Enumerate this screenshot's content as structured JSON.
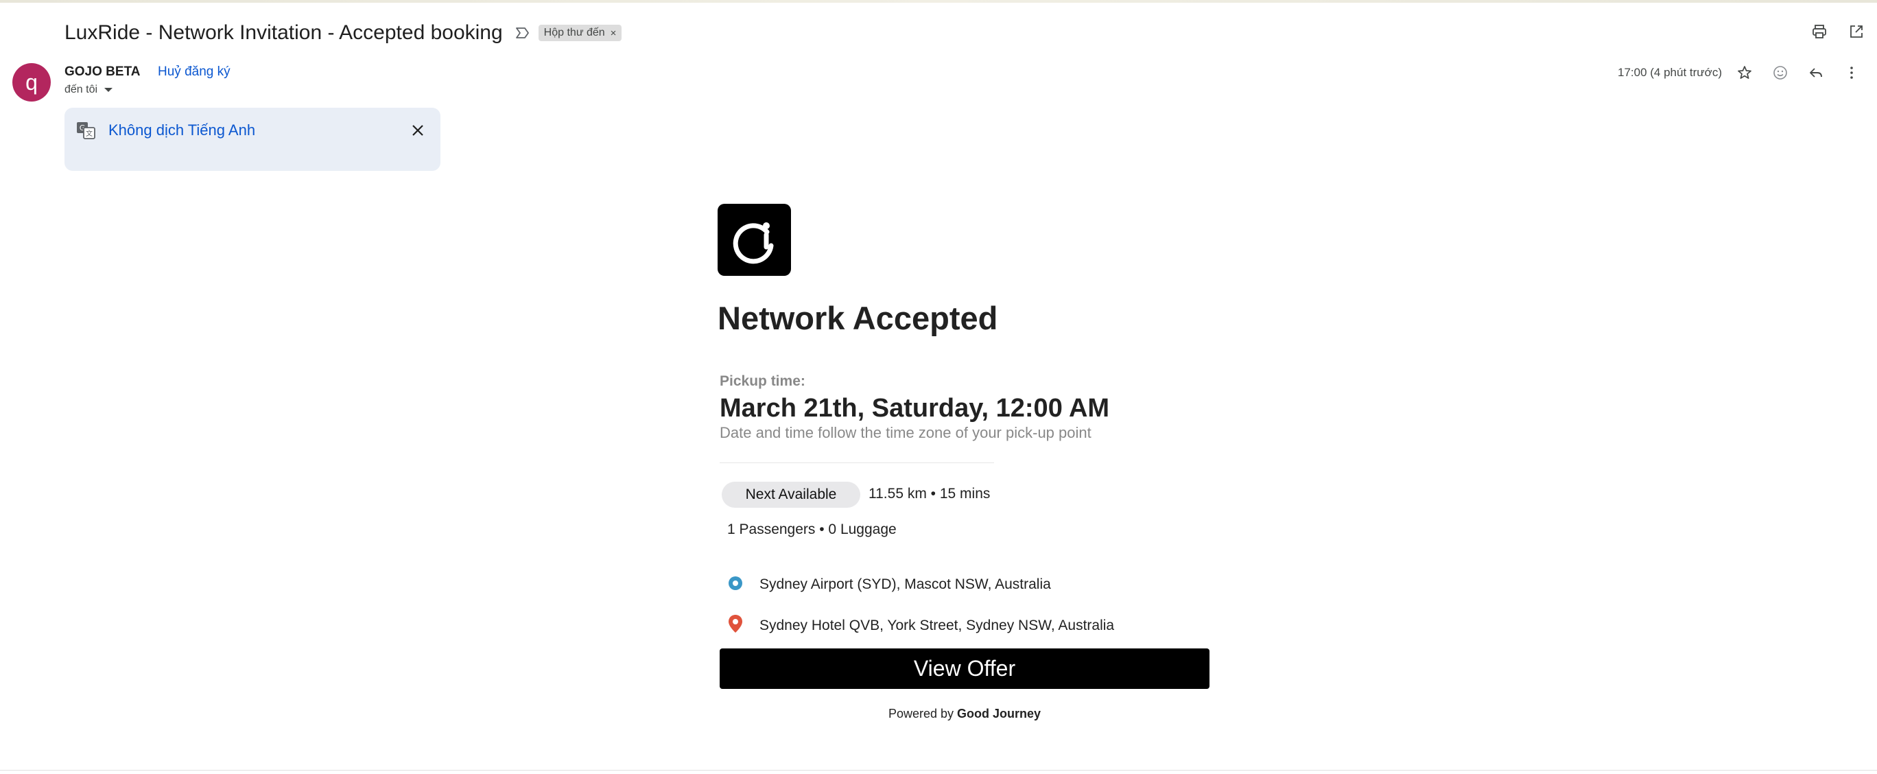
{
  "email": {
    "subject": "LuxRide - Network Invitation - Accepted booking",
    "label_chip": "Hộp thư đến",
    "label_remove": "×",
    "sender_initial": "q",
    "sender_name": "GOJO BETA",
    "unsubscribe": "Huỷ đăng ký",
    "recipient": "đến tôi",
    "time": "17:00 (4 phút trước)"
  },
  "translate_banner": {
    "label": "Không dịch Tiếng Anh"
  },
  "icons": {
    "important": "important-marker-icon",
    "print": "print-icon",
    "open_new_window": "open-in-new-window-icon",
    "star": "star-icon",
    "emoji": "emoji-reaction-icon",
    "reply": "reply-icon",
    "more": "more-vertical-icon",
    "translate": "translate-icon",
    "close": "close-icon",
    "logo": "good-journey-logo",
    "pickup": "pickup-location-icon",
    "dropoff": "dropoff-location-icon"
  },
  "content": {
    "heading": "Network Accepted",
    "pickup_label": "Pickup time:",
    "pickup_time": "March 21th, Saturday, 12:00 AM",
    "pickup_note": "Date and time follow the time zone of your pick-up point",
    "vehicle_class": "Next Available",
    "distance_duration": "11.55 km • 15 mins",
    "passengers_luggage": "1 Passengers • 0 Luggage",
    "pickup_address": "Sydney Airport (SYD), Mascot NSW, Australia",
    "dropoff_address": "Sydney Hotel QVB, York Street, Sydney NSW, Australia",
    "cta_label": "View Offer",
    "powered_prefix": "Powered by",
    "powered_brand": "Good Journey"
  },
  "colors": {
    "avatar": "#b3265e",
    "link": "#0b57d0",
    "banner_bg": "#e9eef6",
    "pickup_marker": "#3a97c7",
    "dropoff_marker": "#e0533c",
    "cta_bg": "#000000"
  }
}
